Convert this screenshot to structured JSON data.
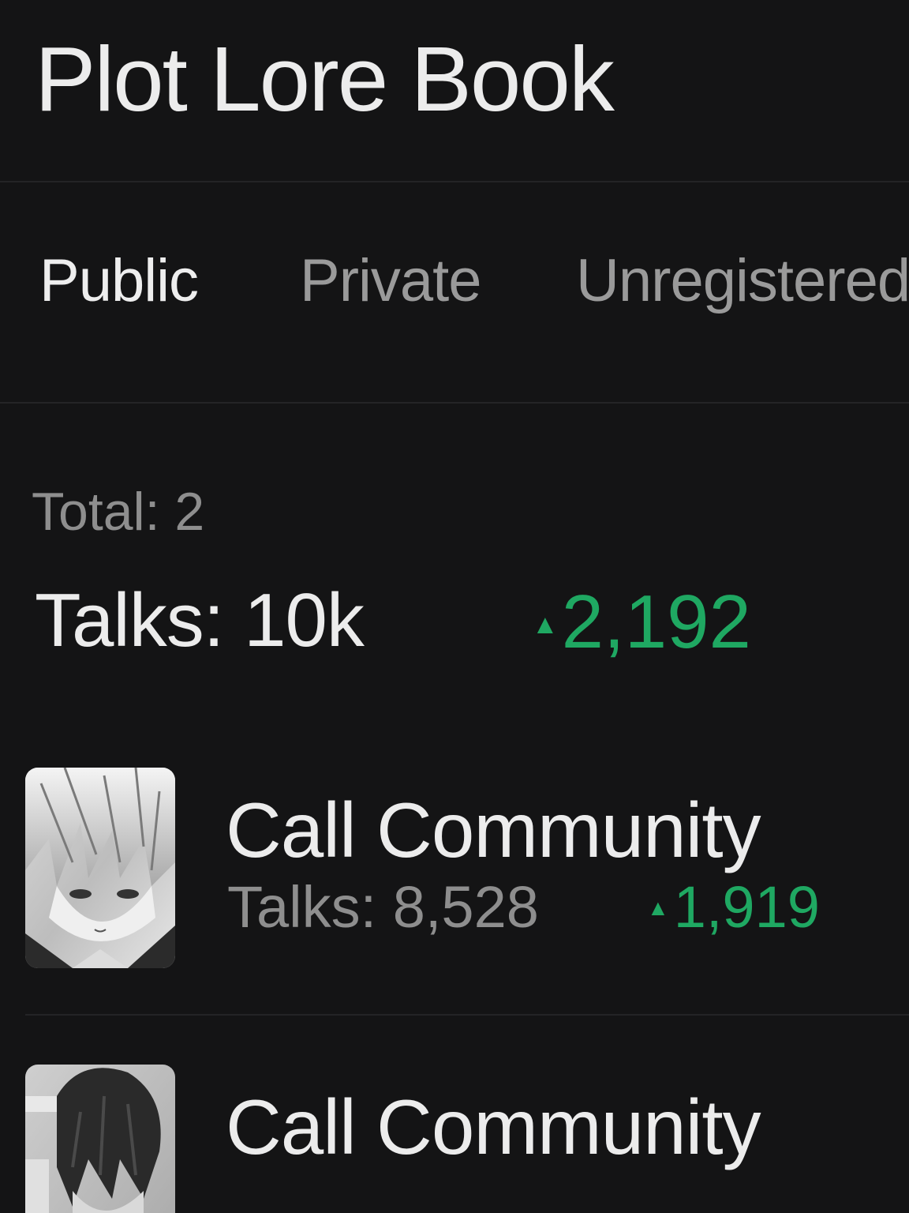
{
  "header": {
    "title": "Plot Lore Book"
  },
  "tabs": [
    {
      "label": "Public",
      "active": true
    },
    {
      "label": "Private",
      "active": false
    },
    {
      "label": "Unregistered",
      "active": false
    }
  ],
  "summary": {
    "total": "Total: 2",
    "talks": "Talks: 10k",
    "delta_icon": "up-triangle-icon",
    "delta_symbol": "▲",
    "delta_value": "2,192"
  },
  "colors": {
    "background": "#141415",
    "primary_text": "#ececec",
    "secondary_text": "#8e8e8e",
    "positive": "#1fa862",
    "divider": "#242426"
  },
  "items": [
    {
      "title": "Call Community",
      "talks": "Talks: 8,528",
      "delta_symbol": "▲",
      "delta_value": "1,919",
      "avatar": "anime-character-avatar-light-hair"
    },
    {
      "title": "Call Community",
      "avatar": "anime-character-avatar-dark-hair"
    }
  ]
}
